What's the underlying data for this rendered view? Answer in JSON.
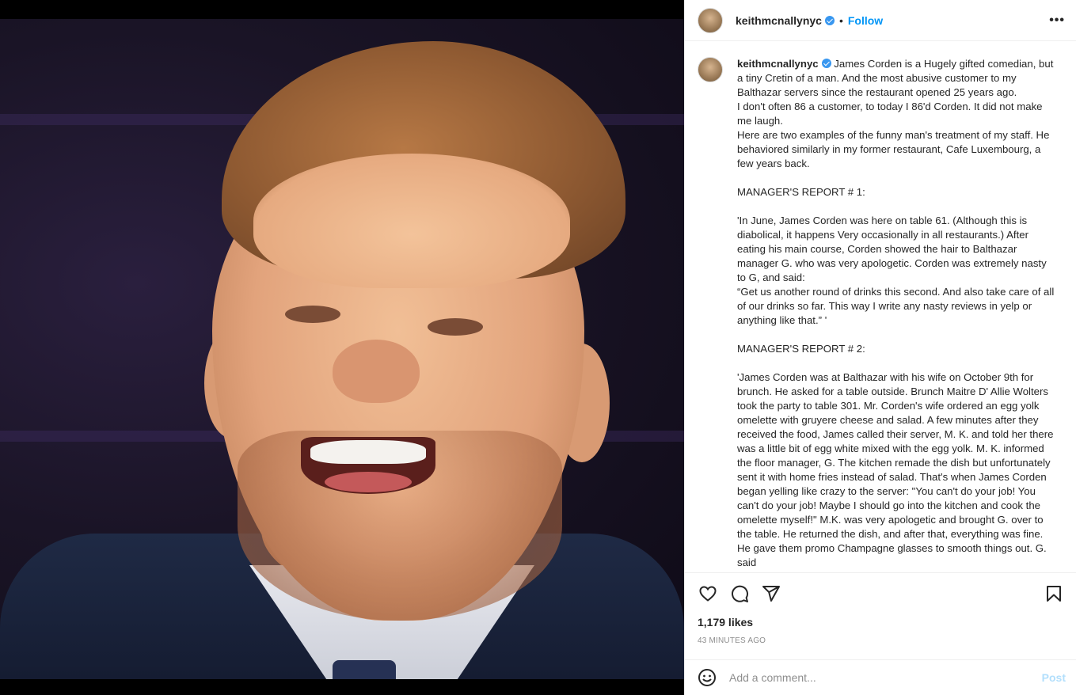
{
  "post": {
    "username": "keithmcnallynyc",
    "separator": "•",
    "follow_label": "Follow",
    "more_label": "•••",
    "caption_username": "keithmcnallynyc",
    "caption": " James Corden is a Hugely gifted comedian, but a tiny Cretin of a man. And the most abusive customer to my Balthazar servers since the restaurant opened 25 years ago.\nI don't often 86 a customer, to today I 86'd Corden. It did not make me laugh.\nHere are two examples of the funny man's treatment of my staff. He behaviored similarly in my former restaurant, Cafe Luxembourg, a few years back.\n\nMANAGER'S REPORT # 1:\n\n'In June, James Corden was here on table 61. (Although this is diabolical, it happens Very occasionally in all restaurants.) After eating his main course, Corden showed the hair to Balthazar manager G. who was very apologetic. Corden was extremely nasty to G, and said:\n“Get us another round of drinks this second. And also take care of all of our drinks so far. This way I write any nasty reviews in yelp or anything like that.” '\n\nMANAGER'S REPORT # 2:\n\n'James Corden was at Balthazar with his wife on October 9th for brunch. He asked for a table outside. Brunch Maitre D' Allie Wolters took the party to table 301. Mr. Corden's wife ordered an egg yolk omelette with gruyere cheese and salad. A few minutes after they received the food, James called their server, M. K. and told her there was a little bit of egg white mixed with the egg yolk. M. K. informed the floor manager, G. The kitchen remade the dish but unfortunately sent it with home fries instead of salad. That's when James Corden began yelling like crazy to the server: \"You can't do your job! You can't do your job! Maybe I should go into the kitchen and cook the omelette myself!\" M.K. was very apologetic and brought G. over to the table. He returned the dish, and after that, everything was fine. He gave them promo Champagne glasses to smooth things out. G. said",
    "likes": "1,179 likes",
    "time": "43 MINUTES AGO"
  },
  "comment": {
    "placeholder": "Add a comment...",
    "post_label": "Post"
  },
  "icons": {
    "like": "heart-icon",
    "comment": "comment-icon",
    "share": "share-icon",
    "save": "bookmark-icon",
    "emoji": "emoji-icon"
  },
  "colors": {
    "accent": "#0095f6",
    "verified": "#3897f0",
    "post_disabled": "#b2dffc"
  }
}
